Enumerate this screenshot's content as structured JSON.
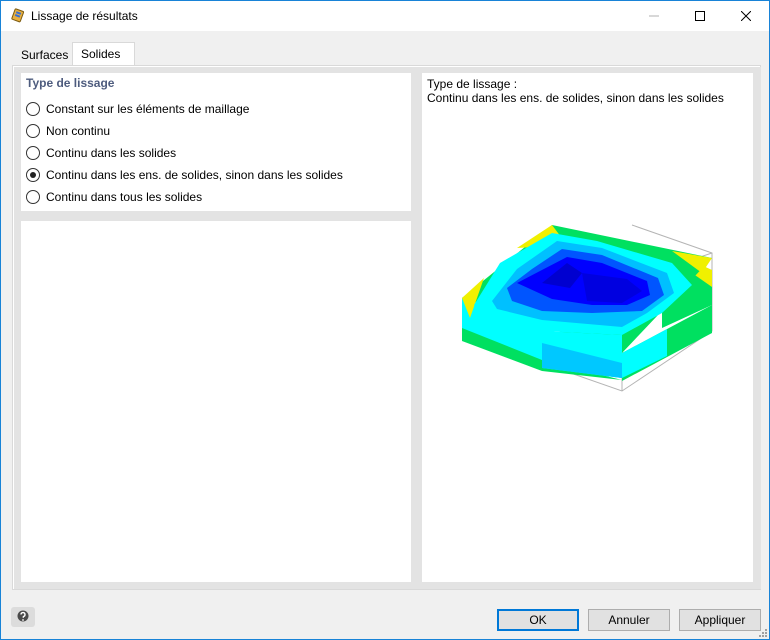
{
  "window": {
    "title": "Lissage de résultats",
    "icon": "smoothing-app-icon"
  },
  "tabs": [
    {
      "label": "Surfaces",
      "active": false
    },
    {
      "label": "Solides",
      "active": true
    }
  ],
  "smoothing": {
    "group_title": "Type de lissage",
    "options": [
      {
        "label": "Constant sur les éléments de maillage",
        "checked": false
      },
      {
        "label": "Non continu",
        "checked": false
      },
      {
        "label": "Continu dans les solides",
        "checked": false
      },
      {
        "label": "Continu dans les ens. de solides, sinon dans les solides",
        "checked": true
      },
      {
        "label": "Continu dans tous les solides",
        "checked": false
      }
    ]
  },
  "preview": {
    "heading": "Type de lissage :",
    "value": "Continu dans les ens. de solides, sinon dans les solides"
  },
  "footer": {
    "ok_label": "OK",
    "cancel_label": "Annuler",
    "apply_label": "Appliquer",
    "help_icon": "help-icon"
  },
  "colors": {
    "accent": "#0078d7",
    "group_title": "#4e5c7e",
    "contour_blue": "#0000ff",
    "contour_cyan": "#00ffff",
    "contour_green": "#00e060",
    "contour_yellow": "#f0f000"
  }
}
